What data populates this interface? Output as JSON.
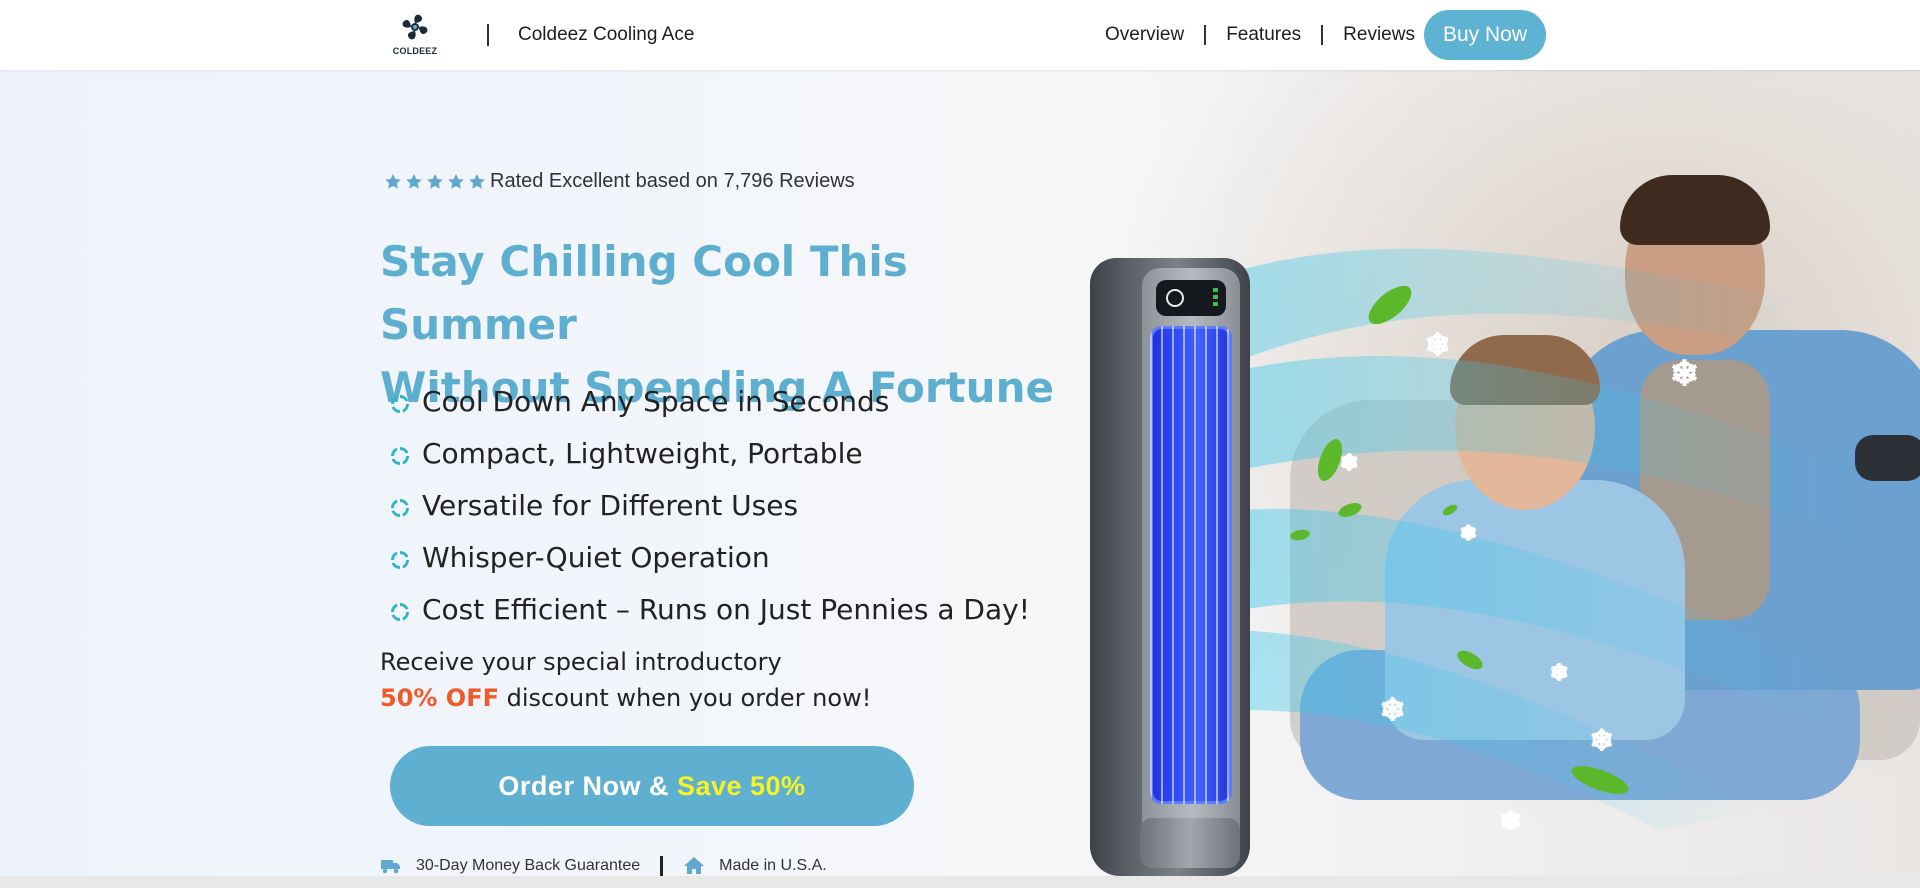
{
  "header": {
    "logo_text": "COLDEEZ",
    "brand_name": "Coldeez Cooling Ace",
    "nav": [
      "Overview",
      "Features",
      "Reviews"
    ],
    "buy_label": "Buy Now"
  },
  "hero": {
    "rating": {
      "stars": 5,
      "text": "Rated Excellent based on 7,796 Reviews"
    },
    "headline_line1": "Stay Chilling Cool This Summer",
    "headline_line2": "Without Spending A Fortune",
    "features": [
      "Cool Down Any Space in Seconds",
      "Compact, Lightweight, Portable",
      "Versatile for Different Uses",
      "Whisper-Quiet Operation",
      "Cost Efficient – Runs on Just Pennies a Day!"
    ],
    "promo_line1": "Receive your special introductory",
    "promo_off": "50% OFF",
    "promo_rest": "discount when you order now!",
    "order_button": {
      "prefix": "Order Now &",
      "highlight": "Save 50%"
    },
    "guarantees": [
      {
        "icon": "truck-icon",
        "label": "30-Day Money Back Guarantee"
      },
      {
        "icon": "home-icon",
        "label": "Made in U.S.A."
      }
    ]
  },
  "colors": {
    "accent": "#5fb3d2",
    "headline": "#5eaed0",
    "offer": "#f05a28",
    "save_highlight": "#f6f326",
    "star": "#5fa8cf",
    "feature_icon": "#33b5c8"
  }
}
